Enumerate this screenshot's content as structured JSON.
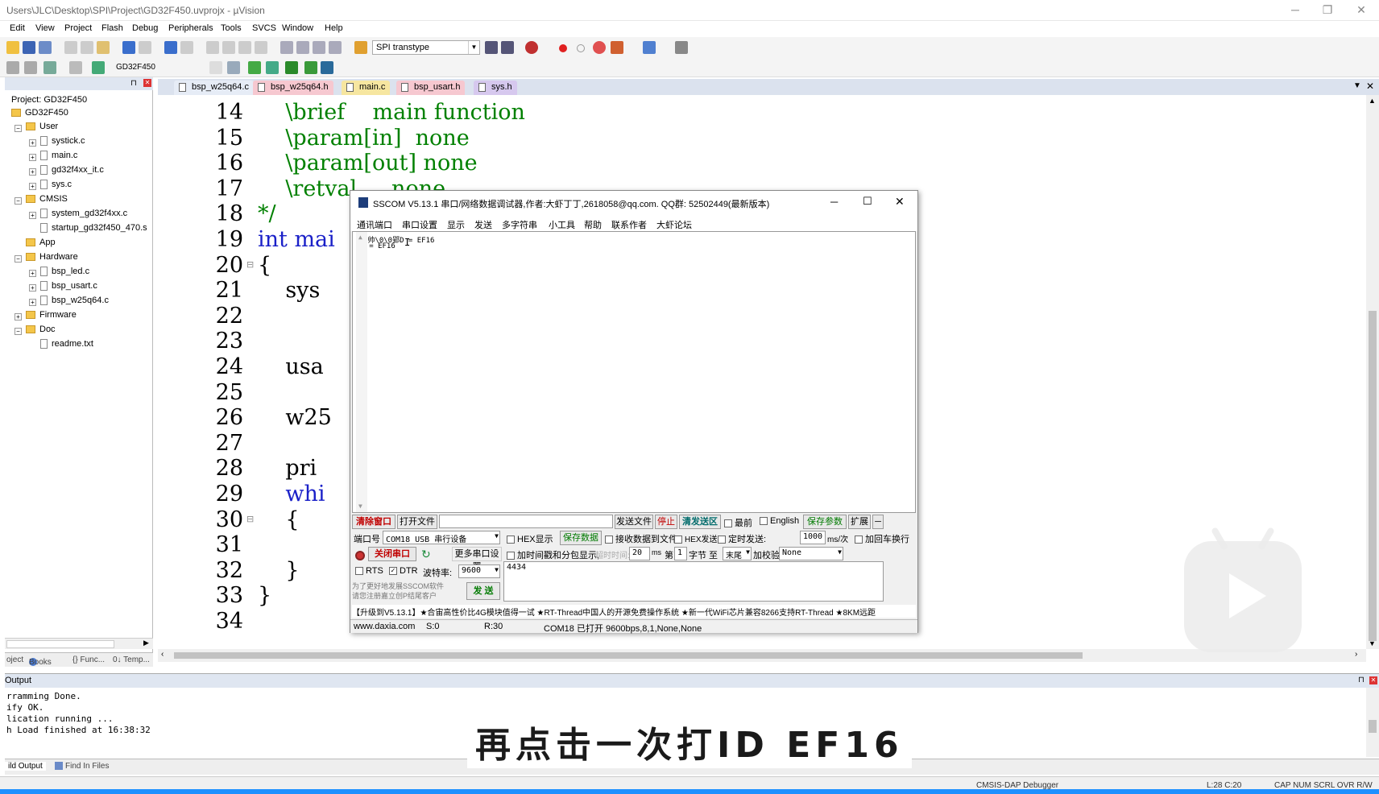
{
  "window": {
    "title": "Users\\JLC\\Desktop\\SPI\\Project\\GD32F450.uvprojx - µVision"
  },
  "menu": [
    "Edit",
    "View",
    "Project",
    "Flash",
    "Debug",
    "Peripherals",
    "Tools",
    "SVCS",
    "Window",
    "Help"
  ],
  "toolbar": {
    "target_combo": "SPI transtype",
    "target_name": "GD32F450"
  },
  "project": {
    "root": "Project: GD32F450",
    "target": "GD32F450",
    "groups": [
      {
        "name": "User",
        "files": [
          "systick.c",
          "main.c",
          "gd32f4xx_it.c",
          "sys.c"
        ]
      },
      {
        "name": "CMSIS",
        "files": [
          "system_gd32f4xx.c",
          "startup_gd32f450_470.s"
        ]
      },
      {
        "name": "App",
        "files": []
      },
      {
        "name": "Hardware",
        "files": [
          "bsp_led.c",
          "bsp_usart.c",
          "bsp_w25q64.c"
        ]
      },
      {
        "name": "Firmware",
        "files": []
      },
      {
        "name": "Doc",
        "files": [
          "readme.txt"
        ]
      }
    ],
    "tabs": [
      "oject",
      "Books",
      "{} Func...",
      "0↓ Temp..."
    ]
  },
  "editor": {
    "tabs": [
      "bsp_w25q64.c",
      "bsp_w25q64.h",
      "main.c",
      "bsp_usart.h",
      "sys.h"
    ],
    "active_tab": "main.c",
    "lines": [
      {
        "no": "14",
        "text": "    \\brief    main function",
        "cls": "cm"
      },
      {
        "no": "15",
        "text": "    \\param[in]  none",
        "cls": "cm"
      },
      {
        "no": "16",
        "text": "    \\param[out] none",
        "cls": "cm"
      },
      {
        "no": "17",
        "text": "    \\retval     none",
        "cls": "cm"
      },
      {
        "no": "18",
        "text": "*/",
        "cls": "cm"
      },
      {
        "no": "19",
        "text": "int mai",
        "cls": "kw"
      },
      {
        "no": "20",
        "text": "{",
        "cls": ""
      },
      {
        "no": "21",
        "text": "    sys",
        "cls": ""
      },
      {
        "no": "22",
        "text": "",
        "cls": ""
      },
      {
        "no": "23",
        "text": "",
        "cls": ""
      },
      {
        "no": "24",
        "text": "    usa",
        "cls": ""
      },
      {
        "no": "25",
        "text": "",
        "cls": ""
      },
      {
        "no": "26",
        "text": "    w25",
        "cls": ""
      },
      {
        "no": "27",
        "text": "",
        "cls": ""
      },
      {
        "no": "28",
        "text": "    pri",
        "cls": ""
      },
      {
        "no": "29",
        "text": "    whi",
        "cls": "kw"
      },
      {
        "no": "30",
        "text": "    {",
        "cls": ""
      },
      {
        "no": "31",
        "text": "",
        "cls": ""
      },
      {
        "no": "32",
        "text": "    }",
        "cls": ""
      },
      {
        "no": "33",
        "text": "}",
        "cls": ""
      },
      {
        "no": "34",
        "text": "",
        "cls": ""
      }
    ]
  },
  "output": {
    "title": "Output",
    "lines": [
      "rramming Done.",
      "ify OK.",
      "lication running ...",
      "h Load finished at 16:38:32"
    ],
    "tabs": [
      "ild Output",
      "Find In Files"
    ]
  },
  "statusbar": {
    "debugger": "CMSIS-DAP Debugger",
    "position": "L:28 C:20",
    "flags": "CAP  NUM  SCRL  OVR  R/W"
  },
  "subtitle": "再点击一次打ID EF16",
  "sscom": {
    "title": "SSCOM V5.13.1 串口/网络数据调试器,作者:大虾丁丁,2618058@qq.com. QQ群: 52502449(最新版本)",
    "menu": [
      "通讯端口",
      "串口设置",
      "显示",
      "发送",
      "多字符串",
      "小工具",
      "帮助",
      "联系作者",
      "大虾论坛"
    ],
    "recv_lines": [
      "郢D帅\\0\\0郢D = EF16",
      "ID = EF16"
    ],
    "buttons": {
      "clear": "清除窗口",
      "open_file": "打开文件",
      "send_file": "发送文件",
      "stop": "停止",
      "clear_send": "清发送区",
      "topmost": "最前",
      "english": "English",
      "save_params": "保存参数",
      "expand": "扩展",
      "close_port": "关闭串口",
      "more_ports": "更多串口设置",
      "send": "发 送",
      "save_data": "保存数据",
      "recv_to_file": "接收数据到文件"
    },
    "labels": {
      "port": "端口号",
      "hex_display": "HEX显示",
      "hex_send": "HEX发送",
      "timed_send": "定时发送:",
      "ms_unit": "ms/次",
      "add_crlf": "加回车换行",
      "timestamp": "加时间戳和分包显示,",
      "timeout": "超时时间:",
      "ms": "ms",
      "nth": "第",
      "byte": "字节 至",
      "checksum": "加校验",
      "rts": "RTS",
      "dtr": "DTR",
      "baud": "波特率:",
      "promo": "为了更好地发展SSCOM软件",
      "promo2": "请您注册嘉立创P结尾客户"
    },
    "values": {
      "port": "COM18 USB 串行设备",
      "period": "1000",
      "timeout": "20",
      "byte_start": "1",
      "byte_end": "末尾",
      "checksum": "None",
      "baud": "9600",
      "send_text": "4434"
    },
    "marquee": "【升级到V5.13.1】★合宙高性价比4G模块值得一试 ★RT-Thread中国人的开源免费操作系统 ★新一代WiFi芯片兼容8266支持RT-Thread ★8KM远距",
    "status": {
      "site": "www.daxia.com",
      "s": "S:0",
      "r": "R:30",
      "port_state": "COM18 已打开  9600bps,8,1,None,None"
    }
  }
}
